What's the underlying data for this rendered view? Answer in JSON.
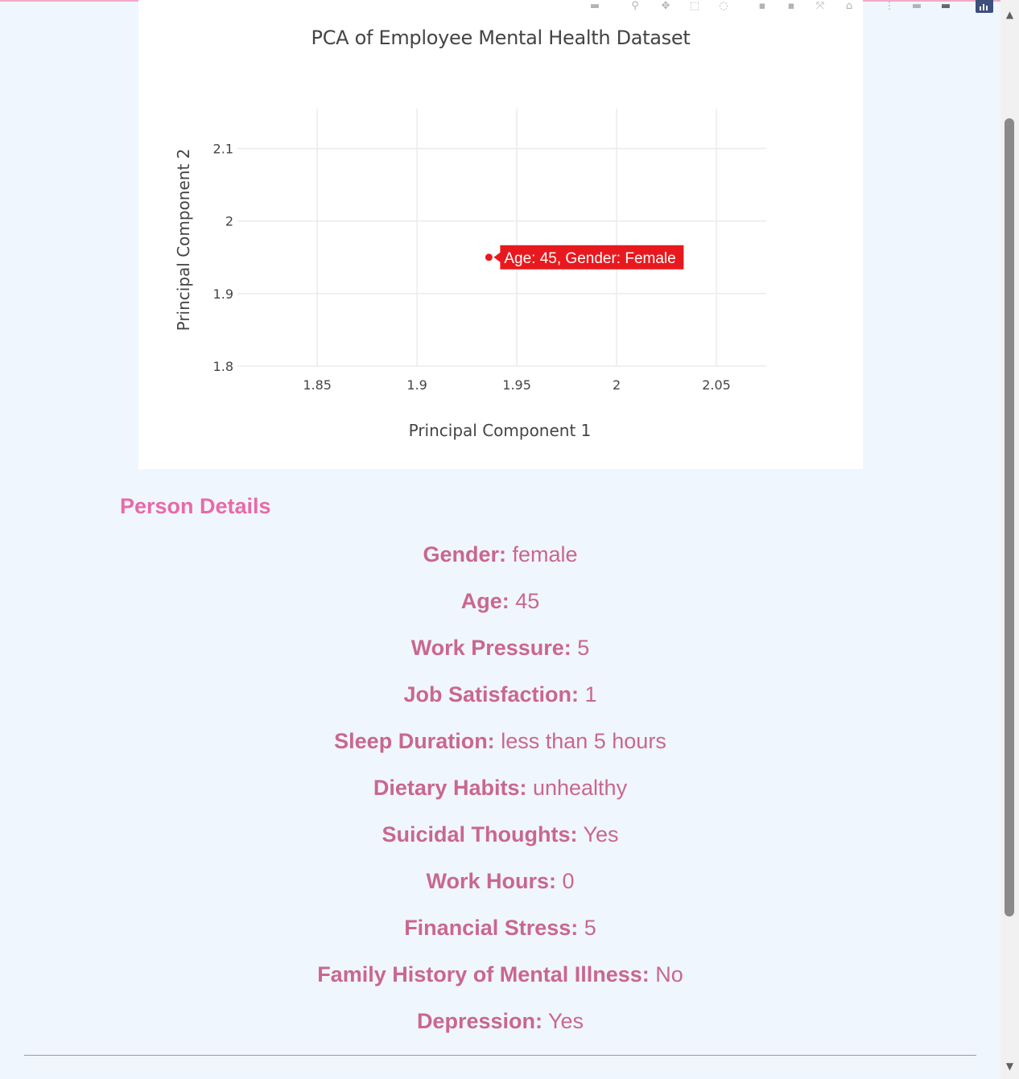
{
  "chart_data": {
    "type": "scatter",
    "title": "PCA of Employee Mental Health Dataset",
    "xlabel": "Principal Component 1",
    "ylabel": "Principal Component 2",
    "xlim": [
      1.81,
      2.075
    ],
    "ylim": [
      1.8,
      2.155
    ],
    "x_ticks": [
      "1.85",
      "1.9",
      "1.95",
      "2",
      "2.05"
    ],
    "x_tick_values": [
      1.85,
      1.9,
      1.95,
      2,
      2.05
    ],
    "y_ticks": [
      "2.1",
      "2",
      "1.9",
      "1.8"
    ],
    "y_tick_values": [
      2.1,
      2.0,
      1.9,
      1.8
    ],
    "grid": true,
    "points": [
      {
        "x": 1.936,
        "y": 1.95,
        "label": "Age: 45, Gender: Female"
      }
    ],
    "marker_color": "#e8191e",
    "hover_color": "#e8191e"
  },
  "modebar": {
    "icons": [
      "camera-icon",
      "zoom-icon",
      "pan-icon",
      "box-select-icon",
      "lasso-icon",
      "zoom-in-icon",
      "zoom-out-icon",
      "autoscale-icon",
      "reset-axes-icon",
      "spike-lines-icon",
      "hover-closest-icon",
      "hover-compare-icon",
      "plotly-logo-icon"
    ]
  },
  "details": {
    "title": "Person Details",
    "rows": [
      {
        "label": "Gender:",
        "value": "female"
      },
      {
        "label": "Age:",
        "value": "45"
      },
      {
        "label": "Work Pressure:",
        "value": "5"
      },
      {
        "label": "Job Satisfaction:",
        "value": "1"
      },
      {
        "label": "Sleep Duration:",
        "value": "less than 5 hours"
      },
      {
        "label": "Dietary Habits:",
        "value": "unhealthy"
      },
      {
        "label": "Suicidal Thoughts:",
        "value": "Yes"
      },
      {
        "label": "Work Hours:",
        "value": "0"
      },
      {
        "label": "Financial Stress:",
        "value": "5"
      },
      {
        "label": "Family History of Mental Illness:",
        "value": "No"
      },
      {
        "label": "Depression:",
        "value": "Yes"
      }
    ]
  },
  "colors": {
    "background": "#f0f6fe",
    "details_title": "#e86aa8",
    "details_text": "#c9678f"
  }
}
